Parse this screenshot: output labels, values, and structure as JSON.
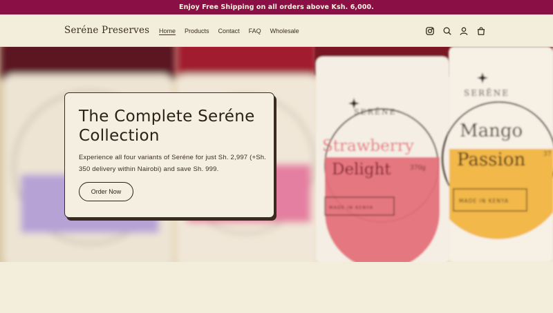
{
  "announcement": "Enjoy Free Shipping on all orders above Ksh. 6,000.",
  "brand": "Seréne Preserves",
  "nav": [
    {
      "label": "Home",
      "active": true
    },
    {
      "label": "Products",
      "active": false
    },
    {
      "label": "Contact",
      "active": false
    },
    {
      "label": "FAQ",
      "active": false
    },
    {
      "label": "Wholesale",
      "active": false
    }
  ],
  "header_icons": [
    "instagram-icon",
    "search-icon",
    "account-icon",
    "cart-icon"
  ],
  "hero": {
    "title": "The Complete Seréne Collection",
    "description": "Experience all four variants of Seréne for just Sh. 2,997 (+Sh. 350 delivery within Nairobi) and save Sh. 999.",
    "cta": "Order Now",
    "jars": [
      {
        "brand": "SERÊNE",
        "flavor_line1": "Strawberry",
        "flavor_line2": "Delight",
        "weight": "370g",
        "origin": "MADE IN KENYA",
        "color": "#e4707a"
      },
      {
        "brand": "SERÊNE",
        "flavor_line1": "Mango",
        "flavor_line2": "Passion",
        "weight": "37",
        "origin": "MADE IN KENYA",
        "color": "#f2b84a"
      }
    ]
  },
  "colors": {
    "announcement_bg": "#8a0f45",
    "page_bg": "#f3eedc",
    "text": "#2b1f17"
  }
}
